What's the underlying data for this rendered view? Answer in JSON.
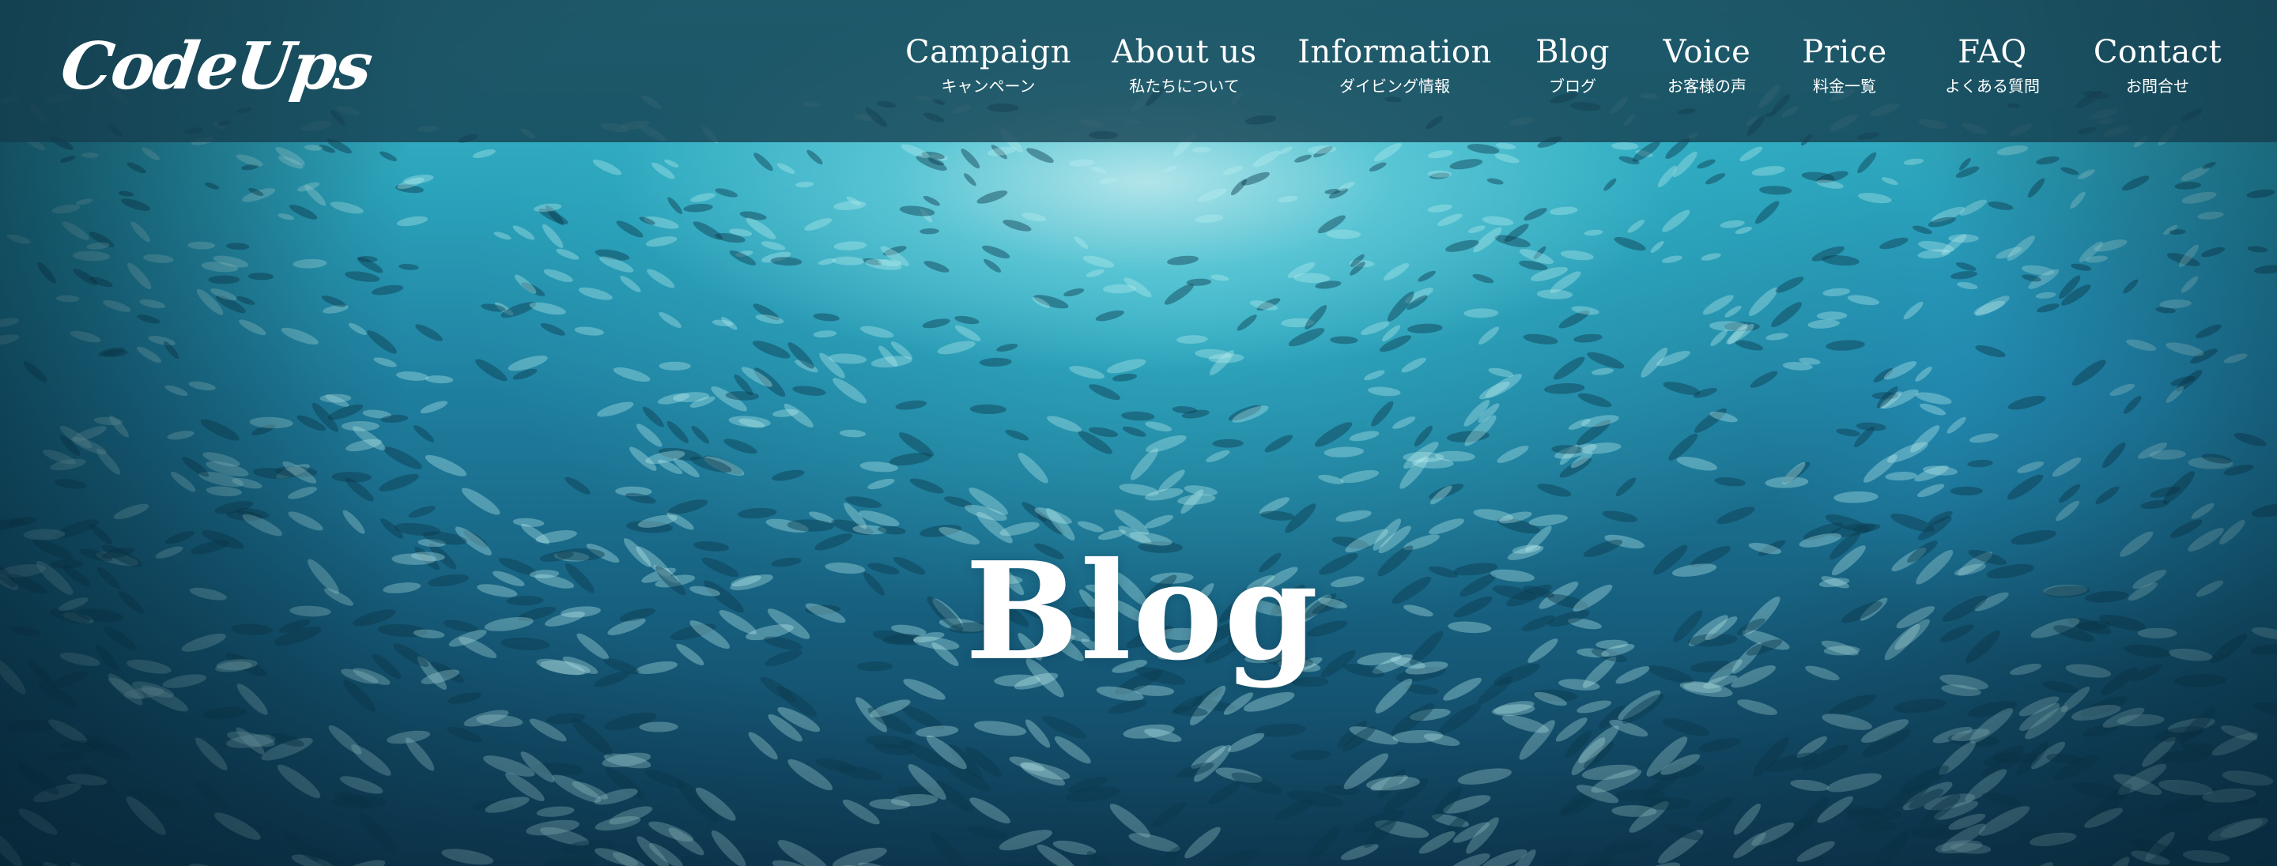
{
  "logo": {
    "text": "CodeUps"
  },
  "nav": {
    "items": [
      {
        "en": "Campaign",
        "ja": "キャンペーン"
      },
      {
        "en": "About us",
        "ja": "私たちについて"
      },
      {
        "en": "Information",
        "ja": "ダイビング情報"
      },
      {
        "en": "Blog",
        "ja": "ブログ"
      },
      {
        "en": "Voice",
        "ja": "お客様の声"
      },
      {
        "en": "Price",
        "ja": "料金一覧"
      },
      {
        "en": "FAQ",
        "ja": "よくある質問"
      },
      {
        "en": "Contact",
        "ja": "お問合せ"
      }
    ]
  },
  "hero": {
    "title": "Blog"
  },
  "colors": {
    "header_overlay": "#143e4e",
    "water_light": "#c8eef0",
    "water_mid": "#2ba3bb",
    "water_deep": "#103f5a",
    "text": "#ffffff"
  }
}
